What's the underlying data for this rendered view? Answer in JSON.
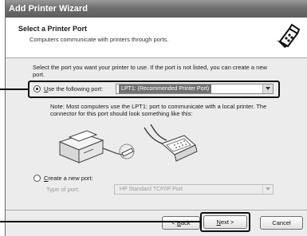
{
  "window": {
    "title": "Add Printer Wizard"
  },
  "header": {
    "title": "Select a Printer Port",
    "subtitle": "Computers communicate with printers through ports.",
    "icon": "printer-port-icon"
  },
  "instructions": "Select the port you want your printer to use.  If the port is not listed, you can create a new port.",
  "use_port": {
    "label_prefix": "",
    "label_underlined": "U",
    "label_rest": "se the following port:",
    "selected": true,
    "value": "LPT1: (Recommended Printer Port)"
  },
  "note": "Note: Most computers use the LPT1: port to communicate with a local printer. The connector for this port should look something like this:",
  "create_port": {
    "label_underlined": "C",
    "label_rest": "reate a new port:",
    "selected": false,
    "type_label": "Type of port:",
    "type_value": "HP Standard TCP/IP Port"
  },
  "buttons": {
    "back": {
      "underlined": "B",
      "prefix": "< ",
      "rest": "ack"
    },
    "next": {
      "underlined": "N",
      "rest": "ext >"
    },
    "cancel": "Cancel"
  }
}
